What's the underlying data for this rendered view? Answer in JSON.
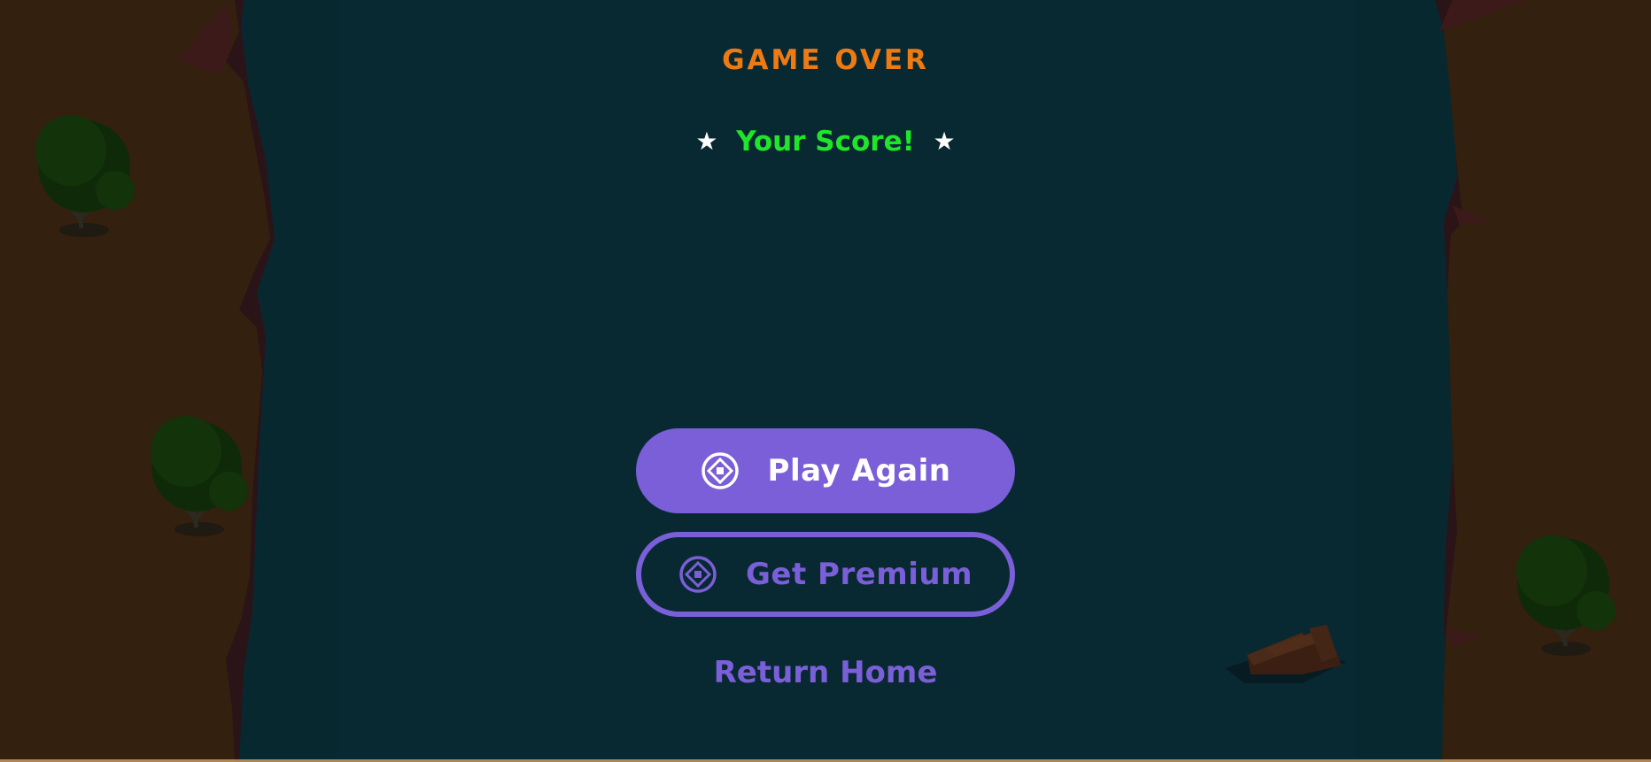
{
  "game": {
    "title": "GAME OVER",
    "score_label": "Your Score!",
    "star_glyph": "★"
  },
  "buttons": {
    "play_again": "Play Again",
    "get_premium": "Get Premium",
    "return_home": "Return Home"
  },
  "colors": {
    "background": "#082830",
    "cliff": "#33200f",
    "title": "#ee7a14",
    "score": "#1fe62a",
    "accent": "#7a5fd8"
  },
  "icons": {
    "play_again": "target-diamond-icon",
    "get_premium": "target-diamond-icon",
    "score_decoration": "star-icon"
  }
}
